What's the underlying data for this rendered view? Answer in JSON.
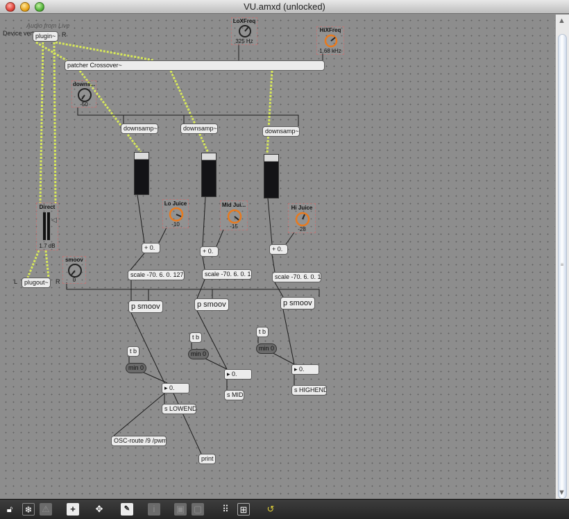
{
  "window": {
    "title": "VU.amxd (unlocked)"
  },
  "header": {
    "device_comment": "Device vert",
    "audio_comment": "Audio from Live",
    "plugin_label": "plugin~",
    "plugin_badge": "R"
  },
  "crossover": {
    "label": "patcher Crossover~"
  },
  "knobs": {
    "loxfreq": {
      "label": "LoXFreq",
      "value": "325 Hz"
    },
    "hixfreq": {
      "label": "HiXFreq",
      "value": "1.68 kHz"
    },
    "downsample": {
      "label": "downs...",
      "value": "-50"
    },
    "lo_juice": {
      "label": "Lo Juice",
      "value": "-10"
    },
    "mid_juice": {
      "label": "Mid Jui...",
      "value": "-15"
    },
    "hi_juice": {
      "label": "Hi Juice",
      "value": "-28"
    },
    "smoov": {
      "label": "smoov",
      "value": "0"
    }
  },
  "downsamp": {
    "label": "downsamp~"
  },
  "direct": {
    "label": "Direct",
    "value": "1.7 dB"
  },
  "plugout": {
    "label": "plugout~",
    "left_badge": "L",
    "right_badge": "R"
  },
  "plus": {
    "label": "+ 0."
  },
  "scales": {
    "lo": "scale -70. 6. 0. 127.",
    "mid": "scale -70. 6. 0. 1.",
    "hi": "scale -70. 6. 0. 1."
  },
  "smoov_obj": {
    "label": "p smoov"
  },
  "tb": {
    "label": "t b"
  },
  "min0": {
    "label": "min 0"
  },
  "flonum": {
    "label": "0."
  },
  "sends": {
    "low": "s LOWEND",
    "mid": "s MID",
    "high": "s HIGHEND"
  },
  "osc": {
    "label": "OSC-route /9 /pwm"
  },
  "print": {
    "label": "print"
  },
  "colors": {
    "cable_audio": "#d7e85a",
    "cable_control": "#1c1c1c",
    "canvas": "#8d8d8d",
    "dial_accent": "#e87a1e"
  },
  "toolbar": {
    "icons": [
      "lock-icon",
      "presentation-icon",
      "warning-icon",
      "new-object-icon",
      "move-icon",
      "inspector-icon",
      "info-icon",
      "front-icon",
      "back-icon",
      "grid-icon",
      "snap-icon",
      "debug-icon"
    ]
  }
}
